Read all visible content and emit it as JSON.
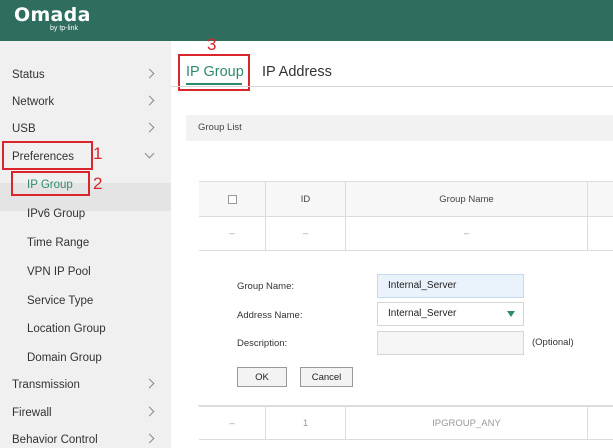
{
  "header": {
    "logo_text": "Omada",
    "logo_sub": "by tp-link",
    "bg_color": "#2f6e5e"
  },
  "sidebar": {
    "items": [
      {
        "label": "Status",
        "expand": "right"
      },
      {
        "label": "Network",
        "expand": "right"
      },
      {
        "label": "USB",
        "expand": "right"
      },
      {
        "label": "Preferences",
        "expand": "down"
      },
      {
        "label": "IP Group",
        "active": true
      },
      {
        "label": "IPv6 Group"
      },
      {
        "label": "Time Range"
      },
      {
        "label": "VPN IP Pool"
      },
      {
        "label": "Service Type"
      },
      {
        "label": "Location Group"
      },
      {
        "label": "Domain Group"
      },
      {
        "label": "Transmission",
        "expand": "right"
      },
      {
        "label": "Firewall",
        "expand": "right"
      },
      {
        "label": "Behavior Control",
        "expand": "right"
      }
    ]
  },
  "tabs": [
    {
      "label": "IP Group",
      "active": true
    },
    {
      "label": "IP Address"
    }
  ],
  "group_list": {
    "title": "Group List"
  },
  "table": {
    "columns": [
      "",
      "ID",
      "Group Name"
    ],
    "rows": [
      [
        "–",
        "–",
        "–"
      ],
      [
        "–",
        "1",
        "IPGROUP_ANY"
      ]
    ]
  },
  "form": {
    "group_name_label": "Group Name:",
    "group_name_value": "Internal_Server",
    "address_name_label": "Address Name:",
    "address_name_value": "Internal_Server",
    "description_label": "Description:",
    "description_value": "",
    "optional": "(Optional)",
    "ok": "OK",
    "cancel": "Cancel"
  },
  "annotations": {
    "n1": "1",
    "n2": "2",
    "n3": "3",
    "color": "#d9262c"
  },
  "accent_color": "#2e8a6d"
}
